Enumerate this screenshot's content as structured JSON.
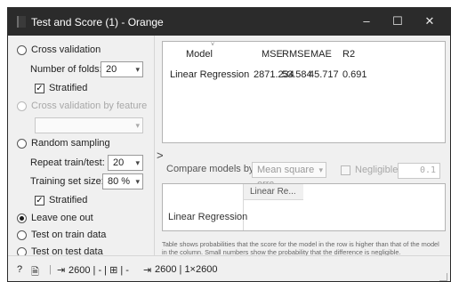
{
  "window": {
    "title": "Test and Score (1) - Orange",
    "minimize": "–",
    "maximize": "☐",
    "close": "✕"
  },
  "sampling": {
    "cross_validation": {
      "label": "Cross validation",
      "selected": false,
      "folds_label": "Number of folds:",
      "folds_value": "20",
      "stratified_label": "Stratified",
      "stratified_checked": true
    },
    "cross_validation_by_feature": {
      "label": "Cross validation by feature",
      "enabled": false,
      "feature_value": ""
    },
    "random_sampling": {
      "label": "Random sampling",
      "selected": false,
      "repeat_label": "Repeat train/test:",
      "repeat_value": "20",
      "train_size_label": "Training set size:",
      "train_size_value": "80 %",
      "stratified_label": "Stratified",
      "stratified_checked": true
    },
    "leave_one_out": {
      "label": "Leave one out",
      "selected": true
    },
    "test_on_train": {
      "label": "Test on train data",
      "selected": false
    },
    "test_on_test": {
      "label": "Test on test data",
      "selected": false
    }
  },
  "splitter": {
    "glyph": ">"
  },
  "results": {
    "columns": [
      "Model",
      "MSE",
      "RMSE",
      "MAE",
      "R2"
    ],
    "rows": [
      {
        "model": "Linear Regression",
        "mse": "2871.234",
        "rmse": "53.584",
        "mae": "45.717",
        "r2": "0.691"
      }
    ],
    "sort_indicator": "˅"
  },
  "compare": {
    "label": "Compare models by:",
    "value": "Mean square errc",
    "negligible_label": "Negligible diff.:",
    "negligible_checked": false,
    "negligible_value": "0.1"
  },
  "comparison_matrix": {
    "column_header": "Linear Re...",
    "row_header": "Linear Regression"
  },
  "note": "Table shows probabilities that the score for the model in the row is higher than that of the model in the column. Small numbers show the probability that the difference is negligible.",
  "statusbar": {
    "help_icon": "?",
    "report_icon": "🗎",
    "input_icon": "⇥",
    "input_summary": "2600 | - | ",
    "input_meta_icon": "⊞",
    "input_meta": " | -",
    "output_icon": "⇥",
    "output_summary": "2600 | 1×2600"
  }
}
